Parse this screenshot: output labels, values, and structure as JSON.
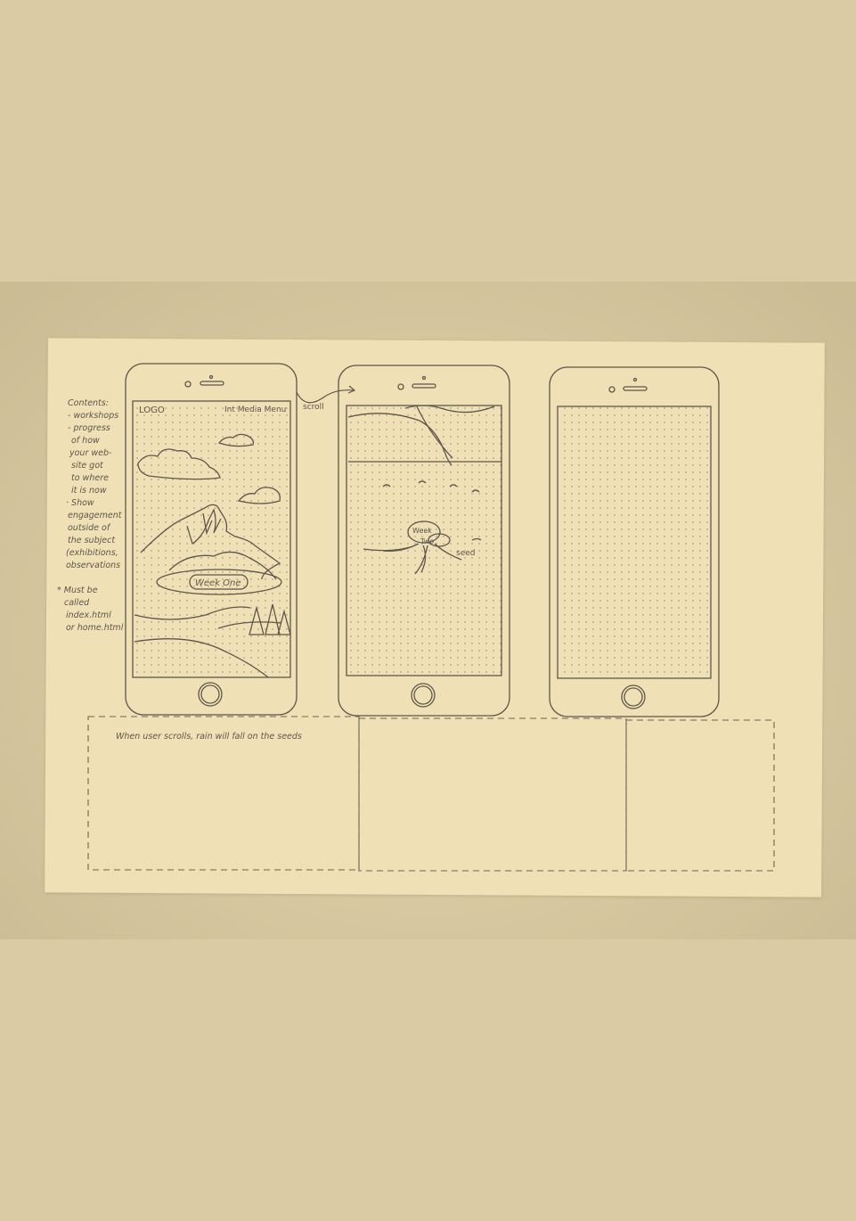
{
  "sketch": {
    "phone1": {
      "logo": "LOGO",
      "nav": "Int Media Menu",
      "pill_label": "Week One"
    },
    "phone2": {
      "pill_label_line1": "Week",
      "pill_label_line2": "Two",
      "seed_label": "seed"
    },
    "scroll_label": "scroll",
    "left_notes": [
      "Contents:",
      "- workshops",
      "- progress",
      "of how",
      "your web-",
      "site got",
      "to where",
      "it is now",
      "· Show",
      "engagement",
      "outside of",
      "the subject",
      "(exhibitions,",
      "observations",
      "* Must be",
      "called",
      "index.html",
      "or home.html"
    ],
    "bottom_note": "When user scrolls, rain will fall on the seeds"
  },
  "colors": {
    "background": "#dbcba4",
    "paper": "#efe0b6",
    "ink": "#5d574c"
  }
}
